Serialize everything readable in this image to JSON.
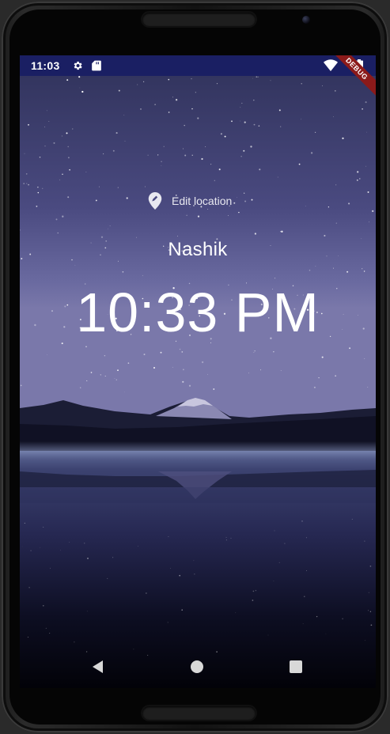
{
  "status_bar": {
    "time": "11:03",
    "icons": [
      "gear-icon",
      "sd-card-icon",
      "wifi-icon",
      "battery-icon"
    ],
    "background": "#1a1f63"
  },
  "debug_banner": "DEBUG",
  "location": {
    "edit_label": "Edit location",
    "icon": "edit-location-pin-icon",
    "city": "Nashik"
  },
  "clock": {
    "time": "10:33 PM"
  },
  "nav_bar": {
    "buttons": [
      "back-icon",
      "home-icon",
      "recents-icon"
    ]
  }
}
